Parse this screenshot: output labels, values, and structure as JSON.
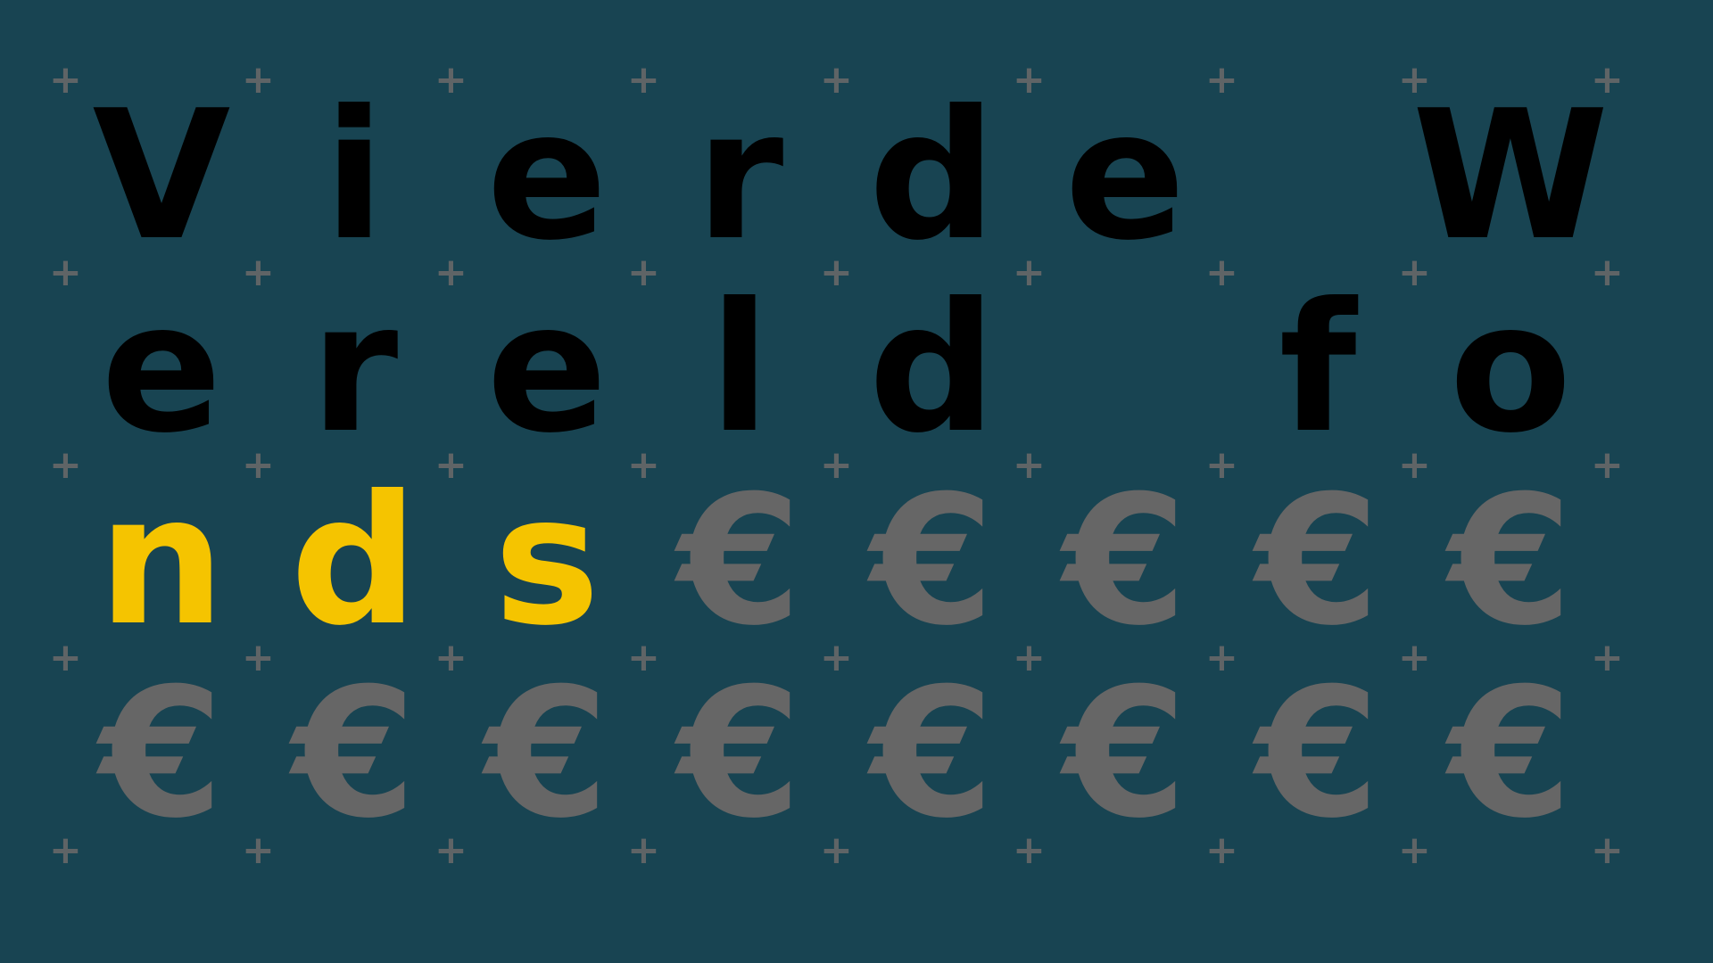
{
  "colors": {
    "background": "#184452",
    "text_dark": "#000000",
    "text_highlight": "#f5c400",
    "euro_symbol": "#666666",
    "plus_marks": "#5f6466"
  },
  "plus_glyph": "+",
  "grid": [
    [
      {
        "char": "V",
        "tone": "dark"
      },
      {
        "char": "i",
        "tone": "dark"
      },
      {
        "char": "e",
        "tone": "dark"
      },
      {
        "char": "r",
        "tone": "dark"
      },
      {
        "char": "d",
        "tone": "dark"
      },
      {
        "char": "e",
        "tone": "dark"
      },
      {
        "char": "",
        "tone": "dark"
      },
      {
        "char": "W",
        "tone": "dark"
      }
    ],
    [
      {
        "char": "e",
        "tone": "dark"
      },
      {
        "char": "r",
        "tone": "dark"
      },
      {
        "char": "e",
        "tone": "dark"
      },
      {
        "char": "l",
        "tone": "dark"
      },
      {
        "char": "d",
        "tone": "dark"
      },
      {
        "char": "",
        "tone": "dark"
      },
      {
        "char": "f",
        "tone": "dark"
      },
      {
        "char": "o",
        "tone": "dark"
      }
    ],
    [
      {
        "char": "n",
        "tone": "yellow"
      },
      {
        "char": "d",
        "tone": "yellow"
      },
      {
        "char": "s",
        "tone": "yellow"
      },
      {
        "char": "€",
        "tone": "grey"
      },
      {
        "char": "€",
        "tone": "grey"
      },
      {
        "char": "€",
        "tone": "grey"
      },
      {
        "char": "€",
        "tone": "grey"
      },
      {
        "char": "€",
        "tone": "grey"
      }
    ],
    [
      {
        "char": "€",
        "tone": "grey"
      },
      {
        "char": "€",
        "tone": "grey"
      },
      {
        "char": "€",
        "tone": "grey"
      },
      {
        "char": "€",
        "tone": "grey"
      },
      {
        "char": "€",
        "tone": "grey"
      },
      {
        "char": "€",
        "tone": "grey"
      },
      {
        "char": "€",
        "tone": "grey"
      },
      {
        "char": "€",
        "tone": "grey"
      }
    ]
  ]
}
